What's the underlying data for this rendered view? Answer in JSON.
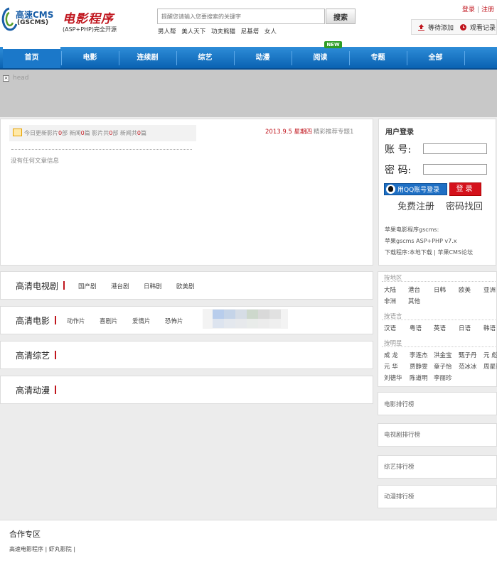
{
  "header": {
    "logo_cms": "高速CMS",
    "logo_gscms": "(GSCMS)",
    "logo_cn": "电影程序",
    "logo_sub": "(ASP+PHP)完全开源",
    "search_placeholder": "提醒您请输入您要搜索的关键字",
    "search_button": "搜索",
    "hot_keywords": [
      "男人帮",
      "美人天下",
      "功夫熊猫",
      "尼基塔",
      "女人"
    ],
    "login_link": "登录",
    "register_link": "注册",
    "action_add": "等待添加",
    "action_history": "观看记录"
  },
  "nav": {
    "items": [
      "首页",
      "电影",
      "连续剧",
      "综艺",
      "动漫",
      "阅读",
      "专题",
      "全部"
    ],
    "active_index": 0,
    "new_badge": "NEW"
  },
  "banner": {
    "head_text": "head"
  },
  "main": {
    "stats_prefix": "今日更新影片",
    "stats_movies": "0",
    "stats_unit1": "部 新闻",
    "stats_news": "0",
    "stats_unit2": "篇 影片共",
    "stats_total": "0",
    "stats_unit3": "部 新闻共",
    "stats_total_news": "0",
    "stats_unit4": "篇",
    "date": "2013.9.5 星期四",
    "promo": "精彩推荐专题1",
    "no_article": "没有任何文章信息"
  },
  "login": {
    "title": "用户登录",
    "account_label": "账 号:",
    "password_label": "密 码:",
    "qq_button": "用QQ账号登录",
    "login_button": "登录",
    "register": "免费注册",
    "forgot": "密码找回",
    "info_line1": "苹果电影程序gscms:",
    "info_line2": "苹果gscms ASP+PHP v7.x",
    "info_line3": "下载程序:本地下载 | 苹果CMS论坛"
  },
  "categories": [
    {
      "title": "高清电视剧",
      "links": [
        "国产剧",
        "港台剧",
        "日韩剧",
        "欧美剧"
      ]
    },
    {
      "title": "高清电影",
      "links": [
        "动作片",
        "喜剧片",
        "爱情片",
        "恐怖片"
      ]
    },
    {
      "title": "高清综艺",
      "links": []
    },
    {
      "title": "高清动漫",
      "links": []
    }
  ],
  "filters": {
    "region_head": "按地区",
    "regions": [
      "大陆",
      "港台",
      "日韩",
      "欧美",
      "亚洲",
      "非洲",
      "其他"
    ],
    "language_head": "按语言",
    "languages": [
      "汉语",
      "粤语",
      "英语",
      "日语",
      "韩语"
    ],
    "star_head": "按明星",
    "stars": [
      "成 龙",
      "李连杰",
      "洪金宝",
      "甄子丹",
      "元 彪",
      "元 华",
      "贾静雯",
      "章子怡",
      "范冰冰",
      "周星驰",
      "刘德华",
      "陈道明",
      "李丽珍"
    ]
  },
  "rankings": [
    "电影排行榜",
    "电视剧排行榜",
    "综艺排行榜",
    "动漫排行榜"
  ],
  "partners": {
    "title": "合作专区",
    "links": [
      "高速电影程序",
      "虾丸影院"
    ]
  }
}
